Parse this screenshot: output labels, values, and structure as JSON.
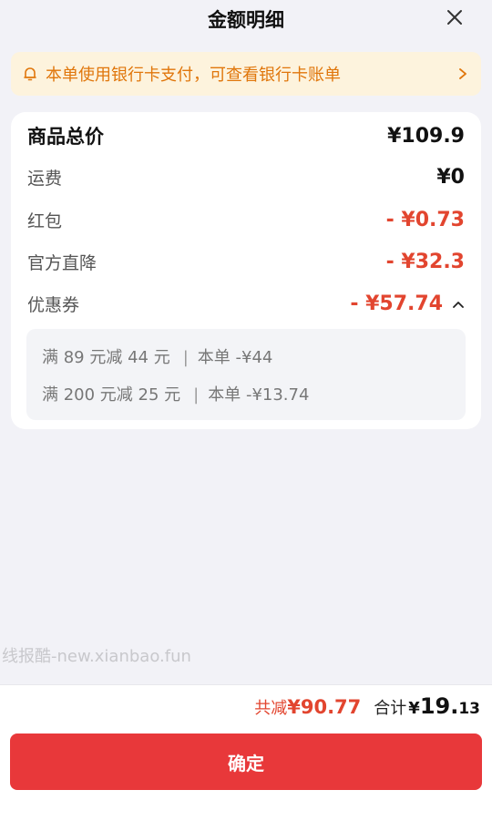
{
  "header": {
    "title": "金额明细"
  },
  "notice": {
    "text": "本单使用银行卡支付，可查看银行卡账单"
  },
  "breakdown": {
    "goods_total_label": "商品总价",
    "goods_total_value": "¥109.9",
    "shipping_label": "运费",
    "shipping_value": "¥0",
    "redpacket_label": "红包",
    "redpacket_value": "- ¥0.73",
    "official_discount_label": "官方直降",
    "official_discount_value": "- ¥32.3",
    "coupon_label": "优惠券",
    "coupon_value": "- ¥57.74",
    "coupons": [
      {
        "rule": "满 89 元减 44 元",
        "applied": "本单  -¥44"
      },
      {
        "rule": "满 200 元减 25 元",
        "applied": "本单  -¥13.74"
      }
    ]
  },
  "watermark": "线报酷-new.xianbao.fun",
  "footer": {
    "save_label": "共减",
    "save_value": "¥90.77",
    "total_label": "合计",
    "total_currency": "¥",
    "total_integer": "19.",
    "total_decimal": "13",
    "confirm_label": "确定"
  },
  "colors": {
    "accent_red": "#e2452f",
    "button_red": "#e8383a",
    "notice_bg": "#fdf3dd",
    "notice_text": "#e0760b",
    "page_bg": "#f2f2f7"
  },
  "icons": {
    "close": "close-icon",
    "bell": "bell-icon",
    "chevron": "chevron-right-icon",
    "caret": "chevron-up-icon"
  }
}
